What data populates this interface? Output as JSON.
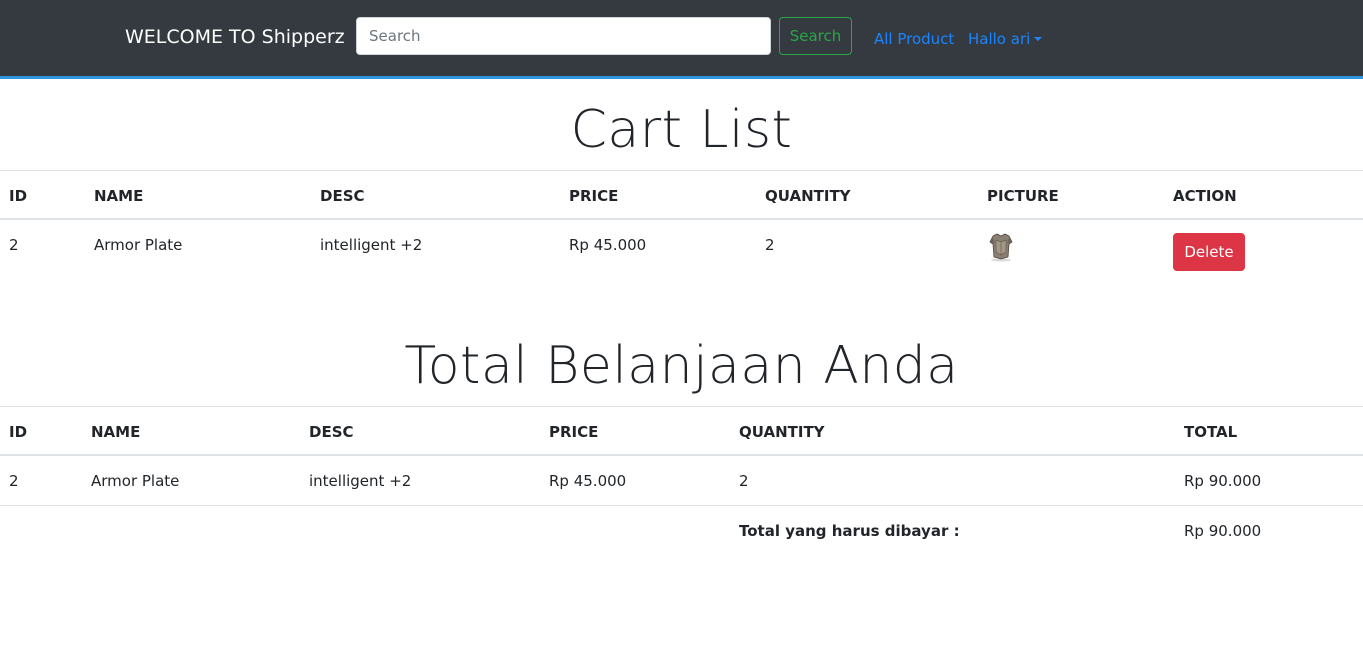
{
  "navbar": {
    "brand": "WELCOME TO Shipperz",
    "search_placeholder": "Search",
    "search_button": "Search",
    "link_all_product": "All Product",
    "link_user": "Hallo ari"
  },
  "cart": {
    "title": "Cart List",
    "headers": [
      "ID",
      "NAME",
      "DESC",
      "PRICE",
      "QUANTITY",
      "PICTURE",
      "ACTION"
    ],
    "rows": [
      {
        "id": "2",
        "name": "Armor Plate",
        "desc": "intelligent +2",
        "price": "Rp 45.000",
        "quantity": "2",
        "picture": "armor-plate-image",
        "action": "Delete"
      }
    ]
  },
  "summary": {
    "title": "Total Belanjaan Anda",
    "headers": [
      "ID",
      "NAME",
      "DESC",
      "PRICE",
      "QUANTITY",
      "TOTAL"
    ],
    "rows": [
      {
        "id": "2",
        "name": "Armor Plate",
        "desc": "intelligent +2",
        "price": "Rp 45.000",
        "quantity": "2",
        "total": "Rp 90.000"
      }
    ],
    "grand_total_label": "Total yang harus dibayar :",
    "grand_total_value": "Rp 90.000"
  },
  "colors": {
    "navbar_bg": "#343a40",
    "navbar_border": "#2f95dc",
    "link": "#1a85ff",
    "search_button": "#28a745",
    "delete_button": "#dc3545"
  }
}
